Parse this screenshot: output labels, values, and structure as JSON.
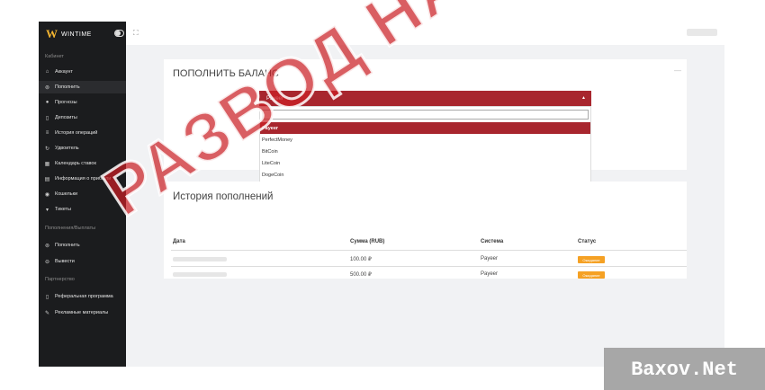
{
  "app": {
    "brand_logo": "W",
    "brand_name": "WINTIME"
  },
  "sidebar": {
    "section_cabinet": "Кабинет",
    "items": [
      {
        "label": "Аккаунт",
        "icon": "home-icon"
      },
      {
        "label": "Пополнить",
        "icon": "wallet-icon",
        "active": true
      },
      {
        "label": "Прогнозы",
        "icon": "globe-icon"
      },
      {
        "label": "Депозиты",
        "icon": "document-icon"
      },
      {
        "label": "История операций",
        "icon": "list-icon"
      },
      {
        "label": "Удвоитель",
        "icon": "refresh-icon"
      },
      {
        "label": "Календарь ставок",
        "icon": "calendar-icon"
      },
      {
        "label": "Информация о прибыли",
        "icon": "info-icon"
      },
      {
        "label": "Кошельки",
        "icon": "coin-icon"
      },
      {
        "label": "Тикеты",
        "icon": "ticket-icon"
      }
    ],
    "section_payments": "Пополнения/Выплаты",
    "payment_items": [
      {
        "label": "Пополнить",
        "icon": "wallet-icon"
      },
      {
        "label": "Вывести",
        "icon": "withdraw-icon"
      }
    ],
    "section_partner": "Партнерство",
    "partner_items": [
      {
        "label": "Реферальная программа",
        "icon": "document-icon"
      },
      {
        "label": "Рекламные материалы",
        "icon": "pencil-icon"
      }
    ]
  },
  "topup": {
    "title": "ПОПОЛНИТЬ БАЛАНС",
    "selected": "Payeer",
    "options": [
      "Payeer",
      "PerfectMoney",
      "BitCoin",
      "LiteCoin",
      "DogeCoin"
    ]
  },
  "history": {
    "title": "История пополнений",
    "columns": [
      "Дата",
      "Сумма (RUB)",
      "Система",
      "Статус"
    ],
    "rows": [
      {
        "amount": "100.00 ₽",
        "system": "Payeer",
        "status": "Ожидание"
      },
      {
        "amount": "500.00 ₽",
        "system": "Payeer",
        "status": "Ожидание"
      }
    ]
  },
  "overlay": {
    "stamp_text": "РАЗВОД НА ДЕНЬГИ",
    "watermark": "Baxov.Net"
  },
  "colors": {
    "sidebar_bg": "#1b1c1e",
    "accent": "#a8262e",
    "badge": "#f5a124",
    "stamp": "#cb2026"
  }
}
